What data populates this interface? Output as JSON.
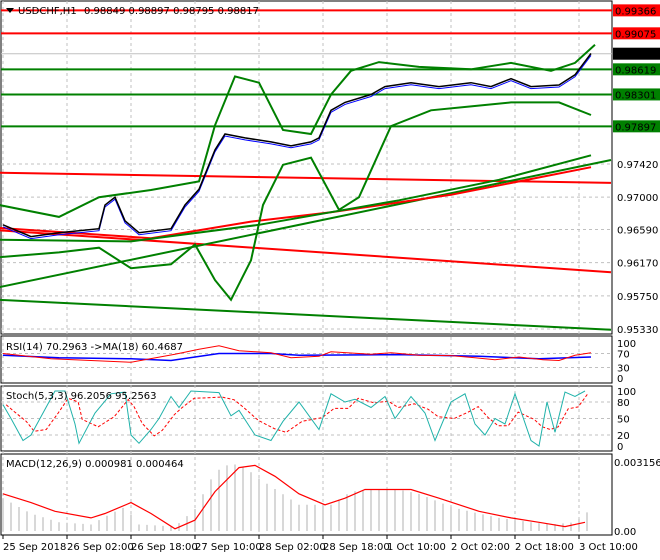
{
  "header": {
    "symbol": "USDCHF,H1",
    "ohlc": "0.98849 0.98897 0.98795 0.98817"
  },
  "chart_data": {
    "type": "line",
    "title": "USDCHF,H1 0.98849 0.98897 0.98795 0.98817",
    "x_unit": "hours since 25 Sep 2018 10:00",
    "x_tick_labels": [
      {
        "h": 0,
        "label": "25 Sep 2018"
      },
      {
        "h": 16,
        "label": "26 Sep 02:00"
      },
      {
        "h": 32,
        "label": "26 Sep 18:00"
      },
      {
        "h": 48,
        "label": "27 Sep 10:00"
      },
      {
        "h": 64,
        "label": "28 Sep 02:00"
      },
      {
        "h": 80,
        "label": "28 Sep 18:00"
      },
      {
        "h": 96,
        "label": "1 Oct 10:00"
      },
      {
        "h": 112,
        "label": "2 Oct 02:00"
      },
      {
        "h": 128,
        "label": "2 Oct 18:00"
      },
      {
        "h": 144,
        "label": "3 Oct 10:00"
      }
    ],
    "price_axis": {
      "ylim": [
        0.9533,
        0.9937
      ],
      "ticks": [
        "0.97420",
        "0.97000",
        "0.96590",
        "0.96170",
        "0.95750",
        "0.95330"
      ]
    },
    "levels": [
      {
        "value": 0.99366,
        "label": "0.99366",
        "color": "#ff0000"
      },
      {
        "value": 0.99075,
        "label": "0.99075",
        "color": "#ff0000"
      },
      {
        "value": 0.98817,
        "label": "0.98817",
        "color": "#000000",
        "current": true
      },
      {
        "value": 0.98619,
        "label": "0.98619",
        "color": "#008000"
      },
      {
        "value": 0.98301,
        "label": "0.98301",
        "color": "#008000"
      },
      {
        "value": 0.97897,
        "label": "0.97897",
        "color": "#008000"
      }
    ],
    "close": [
      [
        0,
        0.9665
      ],
      [
        7,
        0.965
      ],
      [
        14,
        0.9655
      ],
      [
        24,
        0.966
      ],
      [
        25.5,
        0.969
      ],
      [
        28,
        0.97
      ],
      [
        30.5,
        0.967
      ],
      [
        34,
        0.9655
      ],
      [
        42,
        0.966
      ],
      [
        45.5,
        0.969
      ],
      [
        49,
        0.971
      ],
      [
        53,
        0.976
      ],
      [
        55.5,
        0.978
      ],
      [
        60.5,
        0.9775
      ],
      [
        67,
        0.977
      ],
      [
        72,
        0.9765
      ],
      [
        77,
        0.977
      ],
      [
        79,
        0.9775
      ],
      [
        82,
        0.981
      ],
      [
        85.5,
        0.982
      ],
      [
        92,
        0.983
      ],
      [
        95.5,
        0.984
      ],
      [
        102,
        0.9845
      ],
      [
        109,
        0.984
      ],
      [
        117,
        0.9845
      ],
      [
        122,
        0.984
      ],
      [
        127,
        0.985
      ],
      [
        132,
        0.984
      ],
      [
        139,
        0.9842
      ],
      [
        143,
        0.9855
      ],
      [
        147,
        0.9882
      ]
    ],
    "bollinger_upper": [
      [
        -1,
        0.969
      ],
      [
        14,
        0.9675
      ],
      [
        24,
        0.97
      ],
      [
        37,
        0.9709
      ],
      [
        49,
        0.972
      ],
      [
        53,
        0.9791
      ],
      [
        58,
        0.9853
      ],
      [
        64,
        0.9845
      ],
      [
        70,
        0.9785
      ],
      [
        77,
        0.978
      ],
      [
        82,
        0.983
      ],
      [
        87,
        0.986
      ],
      [
        94,
        0.9871
      ],
      [
        104,
        0.9865
      ],
      [
        117,
        0.9862
      ],
      [
        127,
        0.987
      ],
      [
        137,
        0.986
      ],
      [
        143,
        0.987
      ],
      [
        148,
        0.9893
      ]
    ],
    "bollinger_lower": [
      [
        -1,
        0.9624
      ],
      [
        14,
        0.963
      ],
      [
        24,
        0.9636
      ],
      [
        32,
        0.961
      ],
      [
        42,
        0.9615
      ],
      [
        48,
        0.964
      ],
      [
        53,
        0.9595
      ],
      [
        57,
        0.957
      ],
      [
        62,
        0.962
      ],
      [
        65,
        0.969
      ],
      [
        70,
        0.9741
      ],
      [
        77,
        0.975
      ],
      [
        84,
        0.9684
      ],
      [
        89,
        0.97
      ],
      [
        97,
        0.979
      ],
      [
        107,
        0.981
      ],
      [
        117,
        0.9815
      ],
      [
        127,
        0.982
      ],
      [
        139,
        0.982
      ],
      [
        147,
        0.9804
      ]
    ],
    "lines": [
      {
        "color": "#ff0000",
        "points": [
          [
            -1,
            0.9731
          ],
          [
            152,
            0.9718
          ]
        ]
      },
      {
        "color": "#ff0000",
        "points": [
          [
            -1,
            0.9658
          ],
          [
            152,
            0.9605
          ]
        ]
      },
      {
        "color": "#008000",
        "points": [
          [
            -1,
            0.9586
          ],
          [
            152,
            0.9747
          ]
        ]
      },
      {
        "color": "#008000",
        "points": [
          [
            -1,
            0.957
          ],
          [
            152,
            0.9532
          ]
        ]
      },
      {
        "color": "#ff0000",
        "points": [
          [
            -1,
            0.9661
          ],
          [
            37,
            0.9648
          ],
          [
            62,
            0.9669
          ],
          [
            82,
            0.9681
          ],
          [
            112,
            0.9703
          ],
          [
            147,
            0.9738
          ]
        ]
      },
      {
        "color": "#008000",
        "points": [
          [
            -1,
            0.9646
          ],
          [
            32,
            0.9644
          ],
          [
            64,
            0.9665
          ],
          [
            99,
            0.9696
          ],
          [
            124,
            0.9722
          ],
          [
            147,
            0.9753
          ]
        ]
      }
    ],
    "rsi": {
      "label": "RSI(14) 70.2963  ->MA(18) 60.4687",
      "ticks": [
        "100",
        "70",
        "30",
        "0"
      ],
      "rsi": [
        [
          0,
          70
        ],
        [
          12,
          55
        ],
        [
          32,
          45
        ],
        [
          43,
          68
        ],
        [
          49,
          82
        ],
        [
          54,
          92
        ],
        [
          59,
          78
        ],
        [
          67,
          72
        ],
        [
          72,
          58
        ],
        [
          79,
          62
        ],
        [
          82,
          75
        ],
        [
          92,
          68
        ],
        [
          97,
          72
        ],
        [
          104,
          65
        ],
        [
          112,
          64
        ],
        [
          118,
          58
        ],
        [
          123,
          52
        ],
        [
          129,
          60
        ],
        [
          135,
          52
        ],
        [
          139,
          50
        ],
        [
          143,
          65
        ],
        [
          147,
          72
        ]
      ],
      "ma": [
        [
          0,
          65
        ],
        [
          14,
          58
        ],
        [
          32,
          55
        ],
        [
          42,
          50
        ],
        [
          54,
          70
        ],
        [
          67,
          70
        ],
        [
          74,
          65
        ],
        [
          99,
          67
        ],
        [
          119,
          62
        ],
        [
          134,
          55
        ],
        [
          147,
          60
        ]
      ]
    },
    "stoch": {
      "label": "Stoch(5,3,3) 96.2056 95.2563",
      "ticks": [
        "100",
        "80",
        "50",
        "20",
        "0"
      ],
      "main": [
        [
          0,
          75
        ],
        [
          2,
          50
        ],
        [
          5,
          10
        ],
        [
          7,
          20
        ],
        [
          10,
          60
        ],
        [
          13,
          100
        ],
        [
          15.5,
          100
        ],
        [
          18,
          40
        ],
        [
          19,
          5
        ],
        [
          23,
          60
        ],
        [
          27,
          95
        ],
        [
          30.5,
          98
        ],
        [
          32,
          20
        ],
        [
          34,
          5
        ],
        [
          37,
          30
        ],
        [
          39,
          50
        ],
        [
          42,
          90
        ],
        [
          44,
          70
        ],
        [
          47,
          100
        ],
        [
          54,
          97
        ],
        [
          57,
          55
        ],
        [
          59,
          65
        ],
        [
          63,
          20
        ],
        [
          67,
          10
        ],
        [
          70,
          45
        ],
        [
          74,
          80
        ],
        [
          79,
          30
        ],
        [
          82,
          95
        ],
        [
          85.5,
          80
        ],
        [
          88,
          85
        ],
        [
          92,
          70
        ],
        [
          95.5,
          90
        ],
        [
          98,
          50
        ],
        [
          102,
          90
        ],
        [
          105.5,
          60
        ],
        [
          108,
          10
        ],
        [
          112,
          80
        ],
        [
          115.5,
          95
        ],
        [
          118,
          40
        ],
        [
          120.5,
          20
        ],
        [
          123,
          50
        ],
        [
          125.5,
          40
        ],
        [
          128,
          95
        ],
        [
          132,
          10
        ],
        [
          134,
          0
        ],
        [
          136,
          80
        ],
        [
          138,
          25
        ],
        [
          140.5,
          98
        ],
        [
          143,
          90
        ],
        [
          145.5,
          100
        ]
      ]
    },
    "macd": {
      "label": "MACD(12,26,9) 0.000981 0.000464",
      "ticks": [
        "0.003156",
        "0.00"
      ],
      "ylim": [
        0,
        0.003156
      ],
      "hist": [
        [
          0,
          0.0015
        ],
        [
          7,
          0.0008
        ],
        [
          14,
          0.0004
        ],
        [
          22,
          0.0003
        ],
        [
          27,
          0.0008
        ],
        [
          30.5,
          0.0011
        ],
        [
          34,
          0.0003
        ],
        [
          43,
          0.0002
        ],
        [
          48,
          0.001
        ],
        [
          53,
          0.0027
        ],
        [
          57,
          0.0031
        ],
        [
          60.5,
          0.0029
        ],
        [
          64,
          0.0024
        ],
        [
          69,
          0.0018
        ],
        [
          74,
          0.0012
        ],
        [
          82,
          0.0012
        ],
        [
          87,
          0.0018
        ],
        [
          92,
          0.0019
        ],
        [
          99,
          0.0019
        ],
        [
          104,
          0.0017
        ],
        [
          112,
          0.0011
        ],
        [
          119,
          0.0008
        ],
        [
          124,
          0.0006
        ],
        [
          132,
          0.0004
        ],
        [
          137,
          0.0003
        ],
        [
          143,
          0.0004
        ],
        [
          147,
          0.001
        ]
      ],
      "signal": [
        [
          0,
          0.0017
        ],
        [
          7,
          0.0013
        ],
        [
          13,
          0.0009
        ],
        [
          22,
          0.0006
        ],
        [
          25.5,
          0.0008
        ],
        [
          32,
          0.0013
        ],
        [
          37,
          0.0008
        ],
        [
          43,
          0.0001
        ],
        [
          48,
          0.0005
        ],
        [
          53,
          0.0018
        ],
        [
          59,
          0.0029
        ],
        [
          63,
          0.003
        ],
        [
          68,
          0.0025
        ],
        [
          74,
          0.0017
        ],
        [
          80.5,
          0.0012
        ],
        [
          85.5,
          0.0015
        ],
        [
          90.5,
          0.0019
        ],
        [
          102,
          0.0019
        ],
        [
          109,
          0.0015
        ],
        [
          119,
          0.0009
        ],
        [
          127,
          0.0006
        ],
        [
          134,
          0.0004
        ],
        [
          140.5,
          0.0002
        ],
        [
          145.5,
          0.0004
        ]
      ]
    }
  }
}
